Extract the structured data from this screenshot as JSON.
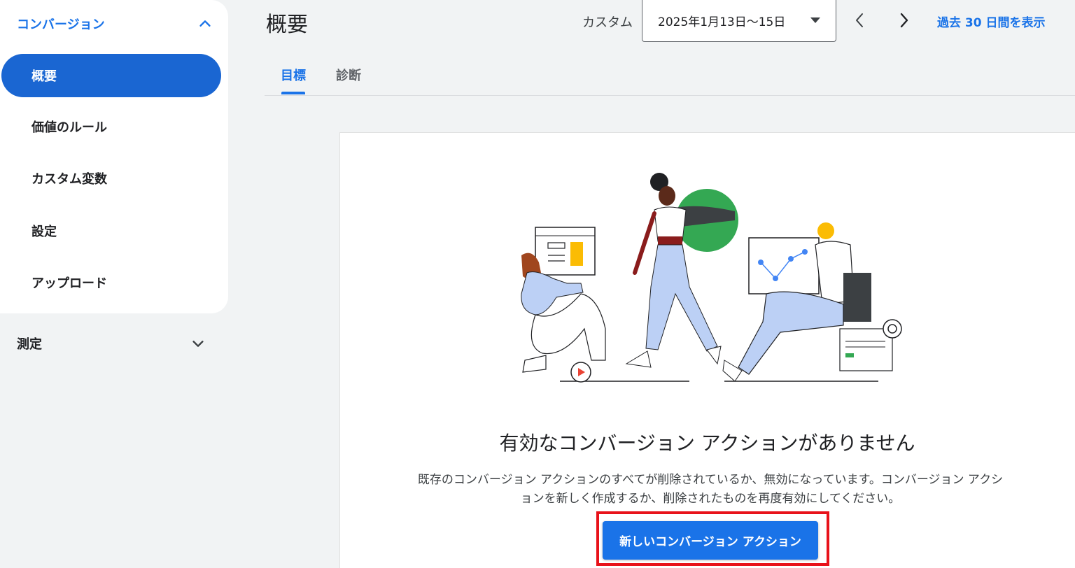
{
  "sidebar": {
    "section_title": "コンバージョン",
    "items": [
      {
        "label": "概要",
        "active": true
      },
      {
        "label": "価値のルール",
        "active": false
      },
      {
        "label": "カスタム変数",
        "active": false
      },
      {
        "label": "設定",
        "active": false
      },
      {
        "label": "アップロード",
        "active": false
      }
    ],
    "collapsed_section": "測定"
  },
  "header": {
    "title": "概要",
    "date_range_label": "カスタム",
    "date_range_value": "2025年1月13日〜15日",
    "show_last_30_days": "過去 30 日間を表示"
  },
  "tabs": [
    {
      "label": "目標",
      "active": true
    },
    {
      "label": "診断",
      "active": false
    }
  ],
  "empty_state": {
    "title": "有効なコンバージョン アクションがありません",
    "description": "既存のコンバージョン アクションのすべてが削除されているか、無効になっています。コンバージョン アクションを新しく作成するか、削除されたものを再度有効にしてください。",
    "button_label": "新しいコンバージョン アクション"
  },
  "colors": {
    "accent": "#1a73e8",
    "active_nav": "#1a66d2",
    "highlight": "#e8121a",
    "background": "#f1f3f4"
  }
}
